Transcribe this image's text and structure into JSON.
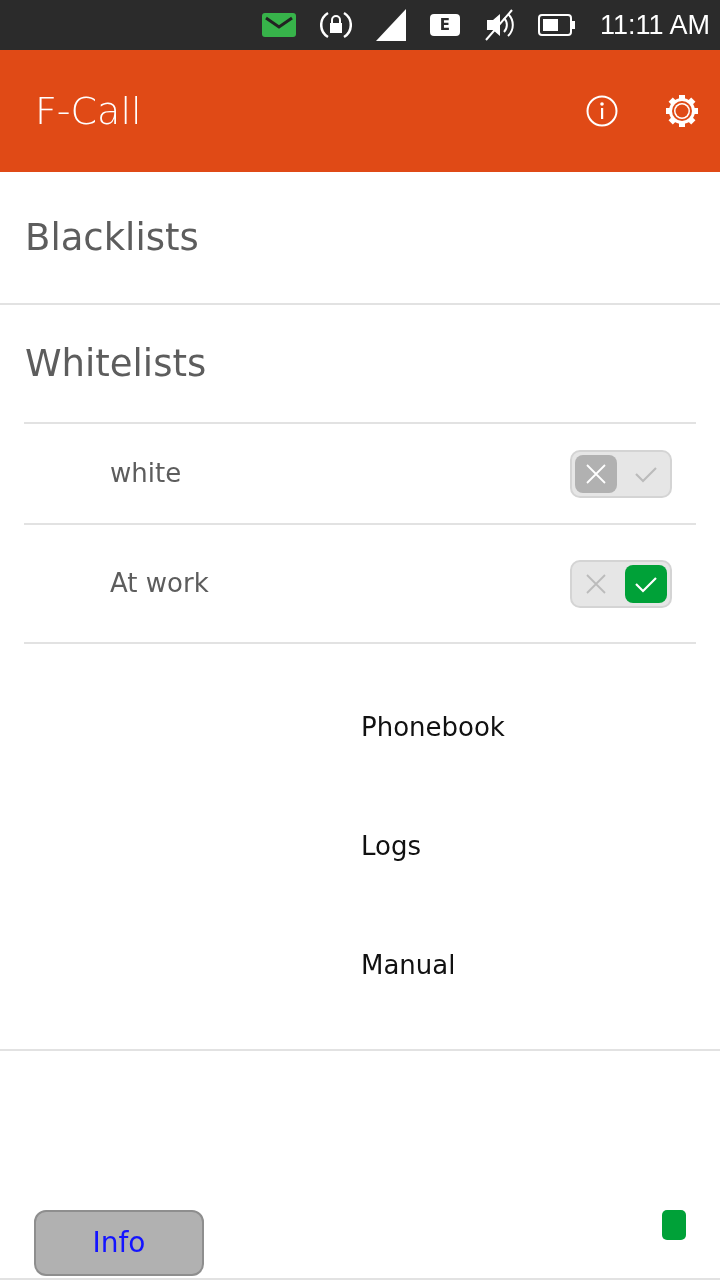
{
  "status_bar": {
    "time": "11:11 AM",
    "network": "E"
  },
  "header": {
    "title": "F-Call"
  },
  "sections": [
    {
      "title": "Blacklists"
    },
    {
      "title": "Whitelists",
      "items": [
        {
          "name": "white",
          "on": false
        },
        {
          "name": "At work",
          "on": true
        }
      ]
    }
  ],
  "menu": [
    "Phonebook",
    "Logs",
    "Manual"
  ],
  "footer": {
    "button": "Info",
    "active": true
  }
}
